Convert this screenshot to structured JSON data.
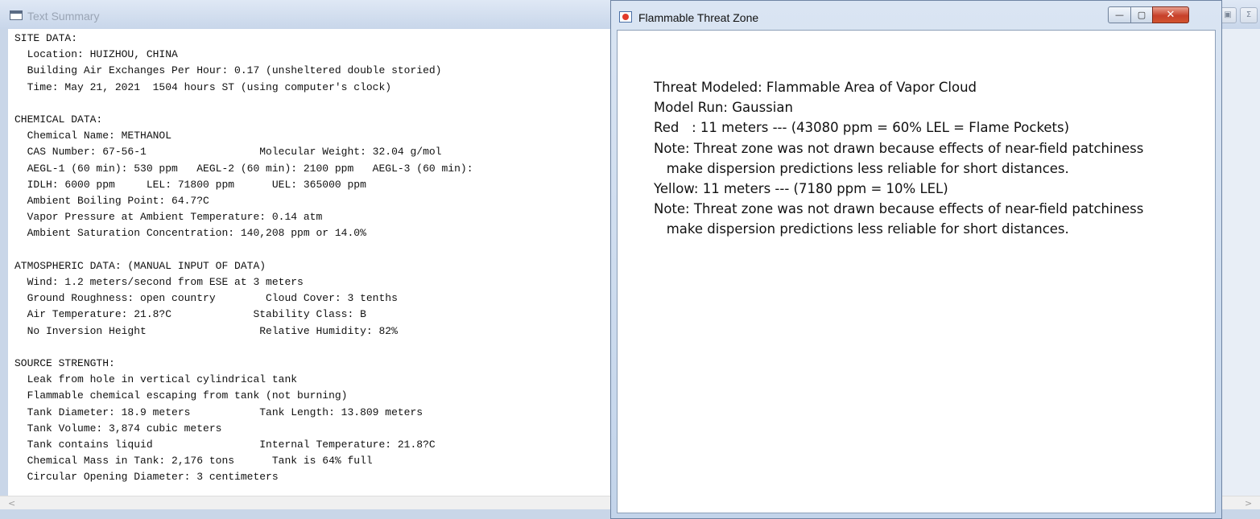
{
  "back_window": {
    "title": "Text Summary",
    "ghost_buttons": [
      "▣",
      "Σ"
    ],
    "lines": [
      "SITE DATA:",
      "  Location: HUIZHOU, CHINA",
      "  Building Air Exchanges Per Hour: 0.17 (unsheltered double storied)",
      "  Time: May 21, 2021  1504 hours ST (using computer's clock)",
      "",
      "CHEMICAL DATA:",
      "  Chemical Name: METHANOL",
      "  CAS Number: 67-56-1                  Molecular Weight: 32.04 g/mol",
      "  AEGL-1 (60 min): 530 ppm   AEGL-2 (60 min): 2100 ppm   AEGL-3 (60 min):",
      "  IDLH: 6000 ppm     LEL: 71800 ppm      UEL: 365000 ppm",
      "  Ambient Boiling Point: 64.7?C",
      "  Vapor Pressure at Ambient Temperature: 0.14 atm",
      "  Ambient Saturation Concentration: 140,208 ppm or 14.0%",
      "",
      "ATMOSPHERIC DATA: (MANUAL INPUT OF DATA)",
      "  Wind: 1.2 meters/second from ESE at 3 meters",
      "  Ground Roughness: open country        Cloud Cover: 3 tenths",
      "  Air Temperature: 21.8?C             Stability Class: B",
      "  No Inversion Height                  Relative Humidity: 82%",
      "",
      "SOURCE STRENGTH:",
      "  Leak from hole in vertical cylindrical tank",
      "  Flammable chemical escaping from tank (not burning)",
      "  Tank Diameter: 18.9 meters           Tank Length: 13.809 meters",
      "  Tank Volume: 3,874 cubic meters",
      "  Tank contains liquid                 Internal Temperature: 21.8?C",
      "  Chemical Mass in Tank: 2,176 tons      Tank is 64% full",
      "  Circular Opening Diameter: 3 centimeters"
    ],
    "scroll_left": "<",
    "scroll_right": ">"
  },
  "front_window": {
    "title": "Flammable Threat Zone",
    "caption_buttons": {
      "minimize": "—",
      "maximize": "▢",
      "close": "✕"
    },
    "lines": [
      "Threat Modeled: Flammable Area of Vapor Cloud",
      "Model Run: Gaussian",
      "Red   : 11 meters --- (43080 ppm = 60% LEL = Flame Pockets)",
      "Note: Threat zone was not drawn because effects of near-field patchiness",
      "   make dispersion predictions less reliable for short distances.",
      "Yellow: 11 meters --- (7180 ppm = 10% LEL)",
      "Note: Threat zone was not drawn because effects of near-field patchiness",
      "   make dispersion predictions less reliable for short distances."
    ]
  },
  "colors": {
    "close_button": "#c7402a",
    "icon_red": "#e23b2c",
    "title_bar": "#c8d6ea"
  },
  "icons": {
    "back_app": "document-icon",
    "front_app": "threat-zone-icon"
  }
}
